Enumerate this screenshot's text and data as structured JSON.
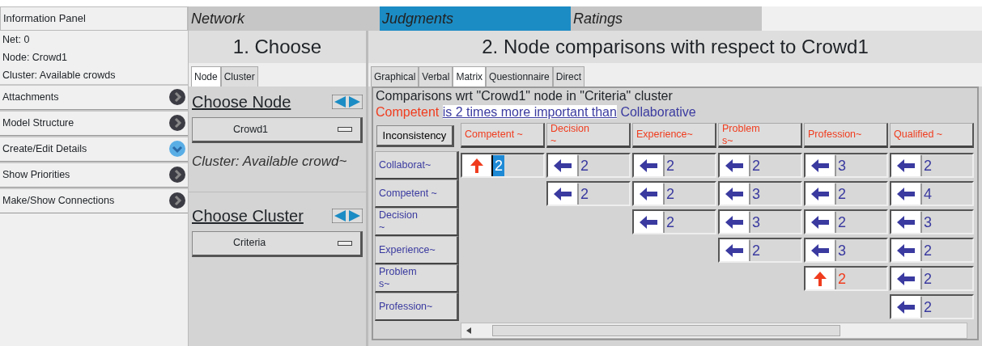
{
  "info_panel": {
    "title": "Information Panel",
    "lines": [
      "Net: 0",
      "Node: Crowd1",
      "Cluster: Available crowds"
    ],
    "items": [
      {
        "label": "Attachments",
        "expanded": false
      },
      {
        "label": "Model Structure",
        "expanded": false
      },
      {
        "label": "Create/Edit Details",
        "expanded": true
      },
      {
        "label": "Show Priorities",
        "expanded": false
      },
      {
        "label": "Make/Show Connections",
        "expanded": false
      }
    ]
  },
  "main_tabs": [
    {
      "label": "Network",
      "selected": false
    },
    {
      "label": "Judgments",
      "selected": true
    },
    {
      "label": "Ratings",
      "selected": false
    }
  ],
  "choose": {
    "title": "1. Choose",
    "tabs": [
      {
        "label": "Node",
        "selected": true
      },
      {
        "label": "Cluster",
        "selected": false
      }
    ],
    "node_heading": "Choose Node",
    "node_value": "Crowd1",
    "cluster_note": "Cluster: Available crowd~",
    "cluster_heading": "Choose Cluster",
    "cluster_value": "Criteria"
  },
  "comparisons": {
    "title": "2. Node comparisons with respect to Crowd1",
    "tabs": [
      {
        "label": "Graphical",
        "selected": false
      },
      {
        "label": "Verbal",
        "selected": false
      },
      {
        "label": "Matrix",
        "selected": true
      },
      {
        "label": "Questionnaire",
        "selected": false
      },
      {
        "label": "Direct",
        "selected": false
      }
    ],
    "caption": "Comparisons wrt \"Crowd1\" node in \"Criteria\" cluster",
    "statement": {
      "dominant": "Competent",
      "phrase": "is 2 times more important than",
      "other": "Collaborative"
    },
    "inconsistency_button": "Inconsistency",
    "columns": [
      "Competent ~",
      "Decision\n~",
      "Experience~",
      "Problem\ns~",
      "Profession~",
      "Qualified ~"
    ],
    "rows": [
      {
        "label": "Collaborat~",
        "cells": [
          {
            "up": true,
            "value": "2",
            "selected": true
          },
          {
            "up": false,
            "value": "2",
            "selected": false
          },
          {
            "up": false,
            "value": "2",
            "selected": false
          },
          {
            "up": false,
            "value": "2",
            "selected": false
          },
          {
            "up": false,
            "value": "3",
            "selected": false
          },
          {
            "up": false,
            "value": "2",
            "selected": false
          }
        ]
      },
      {
        "label": "Competent ~",
        "cells": [
          "",
          {
            "up": false,
            "value": "2",
            "selected": false
          },
          {
            "up": false,
            "value": "2",
            "selected": false
          },
          {
            "up": false,
            "value": "3",
            "selected": false
          },
          {
            "up": false,
            "value": "2",
            "selected": false
          },
          {
            "up": false,
            "value": "4",
            "selected": false
          }
        ]
      },
      {
        "label": "Decision\n~",
        "cells": [
          "",
          "",
          {
            "up": false,
            "value": "2",
            "selected": false
          },
          {
            "up": false,
            "value": "3",
            "selected": false
          },
          {
            "up": false,
            "value": "2",
            "selected": false
          },
          {
            "up": false,
            "value": "3",
            "selected": false
          }
        ]
      },
      {
        "label": "Experience~",
        "cells": [
          "",
          "",
          "",
          {
            "up": false,
            "value": "2",
            "selected": false
          },
          {
            "up": false,
            "value": "3",
            "selected": false
          },
          {
            "up": false,
            "value": "2",
            "selected": false
          }
        ]
      },
      {
        "label": "Problem\ns~",
        "cells": [
          "",
          "",
          "",
          "",
          {
            "up": true,
            "value": "2",
            "selected": false
          },
          {
            "up": false,
            "value": "2",
            "selected": false
          }
        ]
      },
      {
        "label": "Profession~",
        "cells": [
          "",
          "",
          "",
          "",
          "",
          {
            "up": false,
            "value": "2",
            "selected": false
          }
        ]
      }
    ]
  }
}
